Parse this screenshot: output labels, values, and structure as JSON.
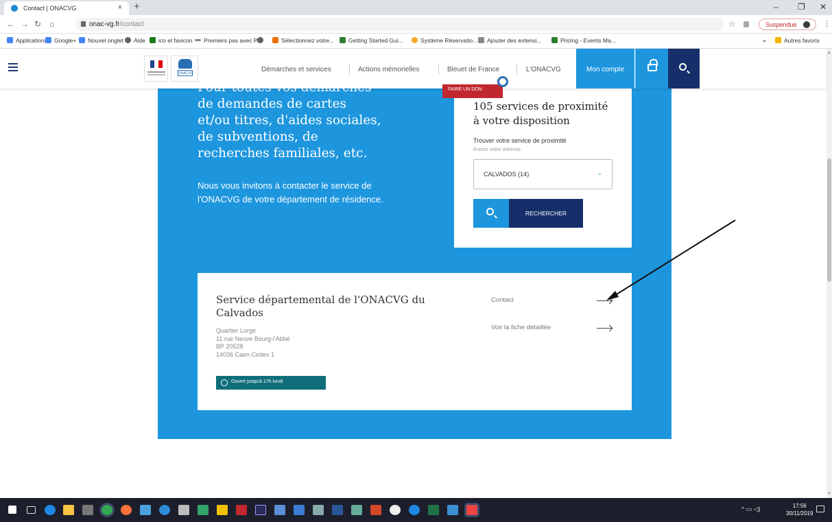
{
  "browser": {
    "tab_title": "Contact | ONACVG",
    "tab_close": "×",
    "new_tab": "+",
    "window_minimize": "–",
    "window_maximize": "❐",
    "window_close": "✕",
    "url_host": "onac-vg.fr",
    "url_path": "/contact",
    "profile_status": "Suspendue"
  },
  "bookmarks": {
    "items": [
      {
        "label": "Applications",
        "color": "#4285f4"
      },
      {
        "label": "Google+",
        "color": "#4285f4"
      },
      {
        "label": "Nouvel onglet",
        "color": "#4285f4"
      },
      {
        "label": "Aide",
        "color": "#5f6368"
      },
      {
        "label": "ico et favicon",
        "color": "#1b7a1b"
      },
      {
        "label": "Premiers pas avec P...",
        "color": "#888888"
      },
      {
        "label": "",
        "color": "#5f6368"
      },
      {
        "label": "Sélectionnez votre...",
        "color": "#e8710a"
      },
      {
        "label": "Getting Started Gui...",
        "color": "#2e7d32"
      },
      {
        "label": "Système Réservatio...",
        "color": "#f9a825"
      },
      {
        "label": "Ajouter des extensi...",
        "color": "#888888"
      },
      {
        "label": "Pricing - Events Ma...",
        "color": "#2e7d32"
      }
    ],
    "more": "»",
    "other_favorites": "Autres favoris"
  },
  "site_nav": {
    "links": [
      "Démarches et services",
      "Actions mémorielles",
      "Bleuet de France",
      "L'ONACVG"
    ],
    "account_label": "Mon compte",
    "donate_label": "FAIRE UN DON",
    "logo_text": "ONACVG"
  },
  "hero": {
    "lines": [
      "Pour toutes vos démarches",
      "de demandes de cartes",
      "et/ou titres, d'aides sociales,",
      "de subventions, de",
      "recherches familiales, etc."
    ],
    "invite": "Nous vous invitons à contacter le service de l'ONACVG de votre département de résidence."
  },
  "proximity": {
    "title_line1": "105 services de proximité",
    "title_line2": "à votre disposition",
    "label": "Trouver votre service de proximité",
    "hint": "Entrez votre adresse",
    "selected_value": "CALVADOS (14)",
    "search_button": "RECHERCHER"
  },
  "service": {
    "title": "Service départemental de l'ONACVG du Calvados",
    "address_lines": [
      "Quartier Lorge",
      "11 rue Neuve Bourg-l'Abbé",
      "BP 20528",
      "14036 Caen Cedex 1"
    ],
    "open_status": "Ouvert jusqu'à 17h lundi",
    "contact_link": "Contact",
    "details_link": "Voir la fiche détaillée"
  },
  "taskbar": {
    "clock_time": "17:56",
    "clock_date": "30/11/2019"
  },
  "colors": {
    "brand_blue": "#1d96de",
    "navy": "#162f6a",
    "donate_red": "#c0282d",
    "status_teal": "#0f6e7a"
  }
}
